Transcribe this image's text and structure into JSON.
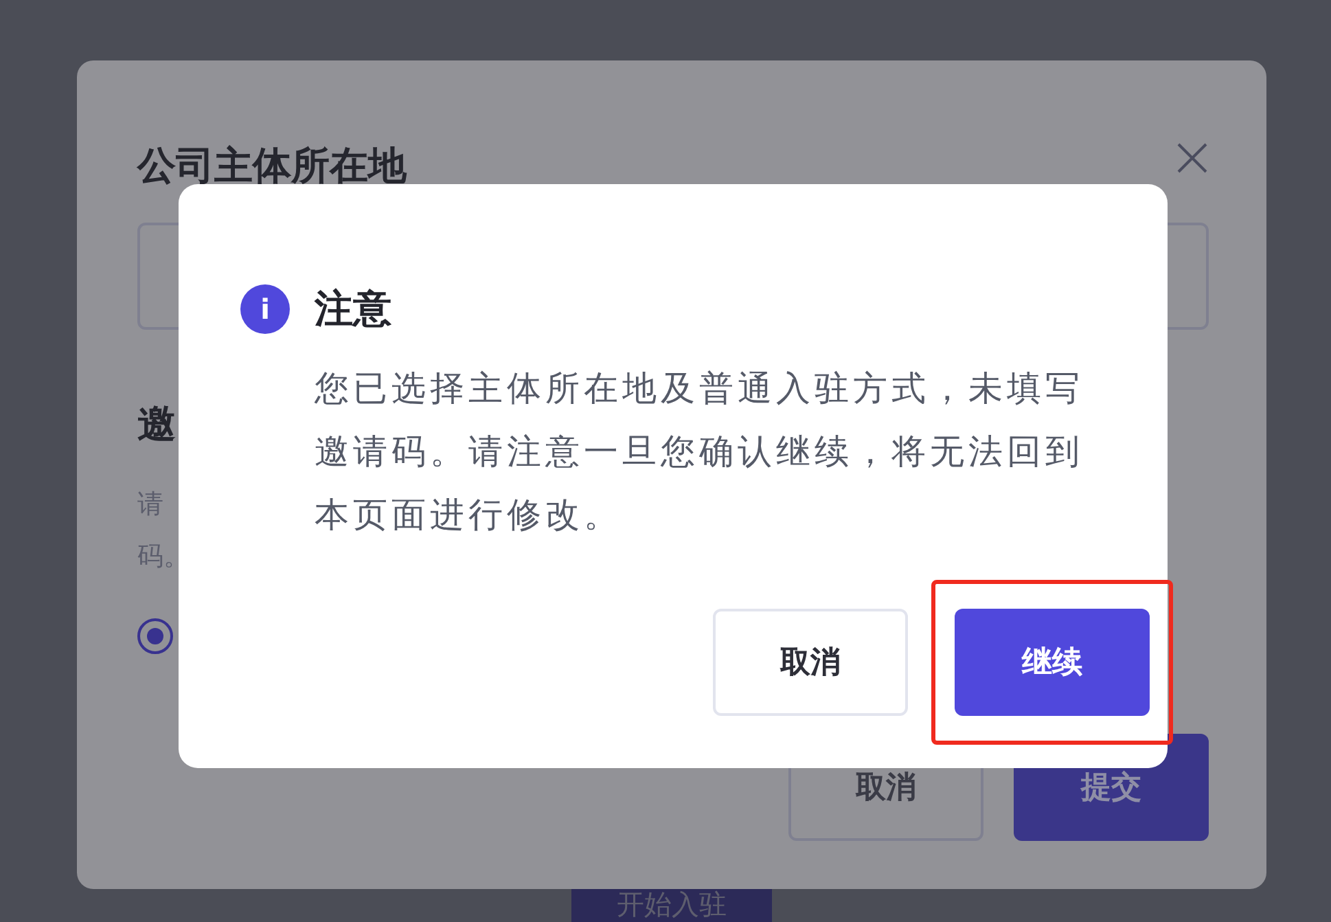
{
  "page_button": {
    "label": "开始入驻"
  },
  "background_dialog": {
    "title": "公司主体所在地",
    "section_heading": "邀",
    "description_lines": [
      "请",
      "码。"
    ],
    "radio": {
      "selected": true
    },
    "buttons": [
      {
        "label": "取消",
        "kind": "secondary"
      },
      {
        "label": "提交",
        "kind": "primary"
      }
    ]
  },
  "alert_dialog": {
    "icon": "i",
    "title": "注意",
    "message": "您已选择主体所在地及普通入驻方式，未填写邀请码。请注意一旦您确认继续，将无法回到本页面进行修改。",
    "buttons": [
      {
        "label": "取消",
        "kind": "secondary",
        "highlighted": false
      },
      {
        "label": "继续",
        "kind": "primary",
        "highlighted": true
      }
    ]
  }
}
